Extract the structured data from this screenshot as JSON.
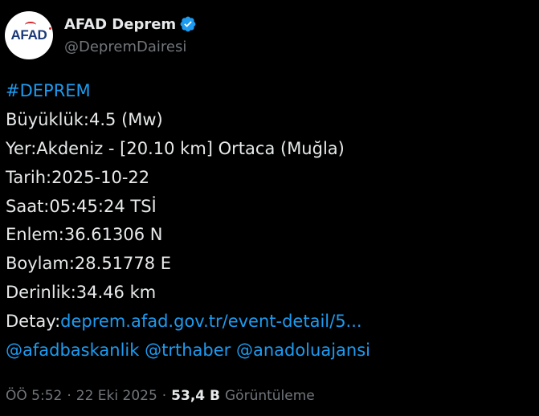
{
  "author": {
    "display_name": "AFAD Deprem",
    "handle": "@DepremDairesi",
    "avatar_text": "AFAD",
    "verified": true
  },
  "tweet": {
    "hashtag": "#DEPREM",
    "lines": {
      "magnitude": "Büyüklük:4.5 (Mw)",
      "location": "Yer:Akdeniz - [20.10 km] Ortaca (Muğla)",
      "date": "Tarih:2025-10-22",
      "time": "Saat:05:45:24 TSİ",
      "latitude": "Enlem:36.61306 N",
      "longitude": "Boylam:28.51778 E",
      "depth": "Derinlik:34.46 km"
    },
    "detail_label": "Detay:",
    "detail_link": "deprem.afad.gov.tr/event-detail/5...",
    "mentions": [
      "@afadbaskanlik",
      "@trthaber",
      "@anadoluajansi"
    ]
  },
  "meta": {
    "time": "ÖÖ 5:52",
    "separator": "·",
    "date": "22 Eki 2025",
    "views_count": "53,4 B",
    "views_label": "Görüntüleme"
  },
  "colors": {
    "background": "#000000",
    "text": "#e7e9ea",
    "secondary_text": "#71767b",
    "link": "#1d9bf0",
    "verified_badge": "#1d9bf0"
  }
}
